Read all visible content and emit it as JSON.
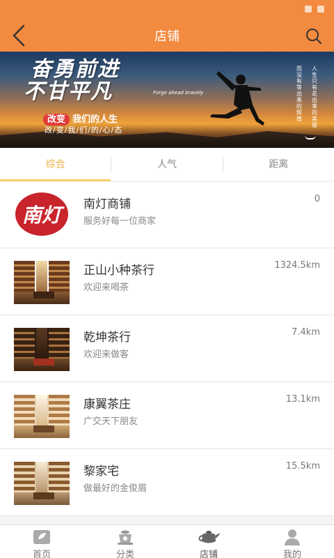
{
  "header": {
    "title": "店铺"
  },
  "banner": {
    "headline_line1": "奋勇前进",
    "headline_line2": "不甘平凡",
    "english": "Forge ahead bravely",
    "sub_pill": "改变",
    "sub_rest": "我们的人生",
    "tagline": "改/变/我/们/的/心/态",
    "vertical_1": "而没有等出来的辉煌",
    "vertical_2": "人生只有走出来的美丽"
  },
  "tabs": [
    {
      "label": "综合",
      "active": true
    },
    {
      "label": "人气",
      "active": false
    },
    {
      "label": "距离",
      "active": false
    }
  ],
  "shops": [
    {
      "name": "南灯商铺",
      "desc": "服务好每一位商家",
      "distance": "0",
      "logo_text": "南灯"
    },
    {
      "name": "正山小种茶行",
      "desc": "欢迎来喝茶",
      "distance": "1324.5km"
    },
    {
      "name": "乾坤茶行",
      "desc": "欢迎来做客",
      "distance": "7.4km"
    },
    {
      "name": "康翼茶庄",
      "desc": "广交天下朋友",
      "distance": "13.1km"
    },
    {
      "name": "黎家宅",
      "desc": "做最好的金俊眉",
      "distance": "15.5km"
    }
  ],
  "tabbar": [
    {
      "label": "首页",
      "icon": "home-icon"
    },
    {
      "label": "分类",
      "icon": "category-icon"
    },
    {
      "label": "店铺",
      "icon": "teapot-icon",
      "active": true
    },
    {
      "label": "我的",
      "icon": "user-icon"
    }
  ],
  "colors": {
    "accent": "#f28a3f",
    "tab_active": "#ecb13d",
    "logo_red": "#c9232b"
  }
}
